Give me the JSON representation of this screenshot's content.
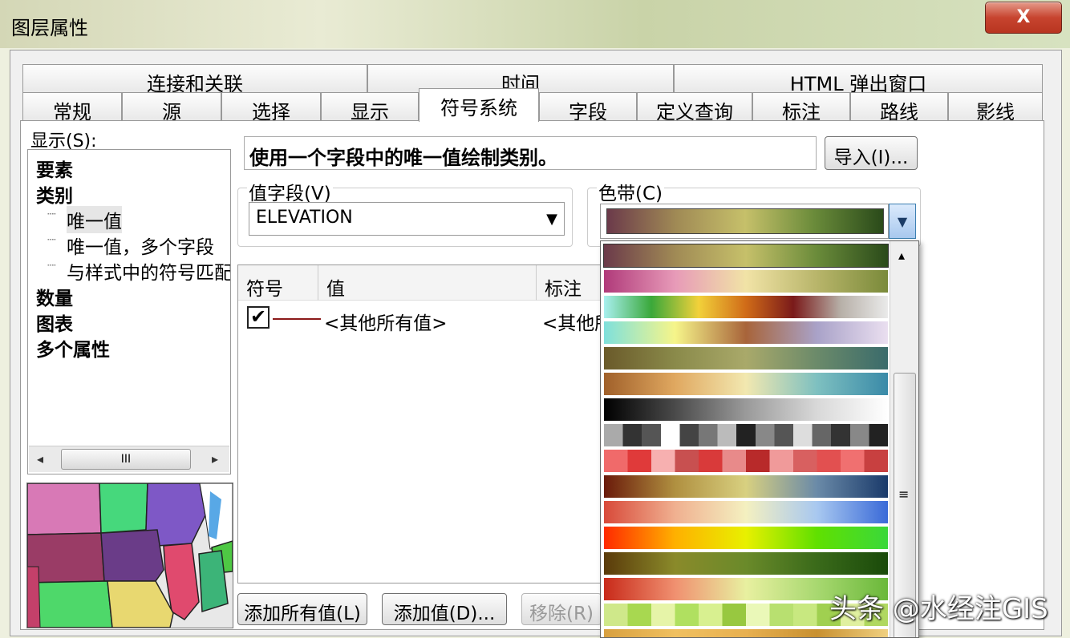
{
  "window": {
    "title": "图层属性",
    "close_label": "X"
  },
  "tabs_row1": [
    "连接和关联",
    "时间",
    "HTML 弹出窗口"
  ],
  "tabs_row2": [
    "常规",
    "源",
    "选择",
    "显示",
    "符号系统",
    "字段",
    "定义查询",
    "标注",
    "路线",
    "影线"
  ],
  "show_label": "显示(S):",
  "tree": {
    "items": [
      "要素",
      "类别",
      "唯一值",
      "唯一值，多个字段",
      "与样式中的符号匹配",
      "数量",
      "图表",
      "多个属性"
    ],
    "connectors": [
      "┈",
      "┈",
      "┈"
    ]
  },
  "tree_scroll": {
    "left_arrow": "◂",
    "right_arrow": "▸",
    "thumb_grip": "III"
  },
  "description": "使用一个字段中的唯一值绘制类别。",
  "import_button": "导入(I)...",
  "value_field": {
    "label": "值字段(V)",
    "value": "ELEVATION",
    "arrow": "▼"
  },
  "color_ramp": {
    "label": "色带(C)",
    "arrow": "▼"
  },
  "list": {
    "headers": [
      "符号",
      "值",
      "标注"
    ],
    "rows": [
      {
        "checked": "✔",
        "value": "<其他所有值>",
        "label": "<其他所有值>"
      }
    ]
  },
  "buttons": {
    "add_all": "添加所有值(L)",
    "add_value": "添加值(D)...",
    "remove": "移除(R)"
  },
  "popup_scroll": {
    "up_arrow": "▴",
    "grip": "≡"
  },
  "watermark": "头条 @水经注GIS",
  "ramps": [
    [
      "#6b3a4a",
      "#a08a55",
      "#c6c06a",
      "#6a8b3a",
      "#2a4a1a"
    ],
    [
      "#b03a7a",
      "#e79ab8",
      "#f1e3a6",
      "#b8b56a",
      "#7a8a3a"
    ],
    [
      "#a8f0ef",
      "#3aa83a",
      "#f2d13a",
      "#d06b18",
      "#7a1a1a",
      "#b7b0a8",
      "#eaeaea"
    ],
    [
      "#7ee0dc",
      "#f6f58a",
      "#a8643a",
      "#a9a2c8",
      "#eadff0"
    ],
    [
      "#6a5a2a",
      "#8a8a4a",
      "#a9a96a",
      "#6b8a6a",
      "#3a6b6b"
    ],
    [
      "#a0602a",
      "#e0a860",
      "#f2e8b0",
      "#7ec0c0",
      "#3a8aa8"
    ],
    [
      "#000000",
      "#4a4a4a",
      "#9a9a9a",
      "#d8d8d8",
      "#ffffff"
    ],
    [
      "#aaaaaa",
      "#333333",
      "#555555",
      "#ffffff",
      "#444444",
      "#777777",
      "#bbbbbb",
      "#222222",
      "#888888",
      "#555555",
      "#dddddd",
      "#666666",
      "#333333",
      "#888888",
      "#222222"
    ],
    [
      "#f06a6a",
      "#e03a3a",
      "#f7b0b0",
      "#c85050",
      "#d93a3a",
      "#e88a8a",
      "#b82a2a",
      "#f09a9a",
      "#d86060",
      "#e25050",
      "#f07070",
      "#c84040"
    ],
    [
      "#6a1a0a",
      "#b09040",
      "#d8d080",
      "#6a8aa8",
      "#1a3a6a"
    ],
    [
      "#d84a3a",
      "#f0b090",
      "#f4f0c0",
      "#a8c8f0",
      "#3a6ad8"
    ],
    [
      "#ff2a00",
      "#ffb000",
      "#e8f000",
      "#60e000",
      "#3ad83a"
    ],
    [
      "#5a3a0a",
      "#8a8a2a",
      "#6a8a2a",
      "#3a6a1a",
      "#1a4a0a"
    ],
    [
      "#c82a1a",
      "#f09070",
      "#e8f0a0",
      "#a8d870",
      "#6ab83a"
    ],
    [
      "#cfe88a",
      "#a8d850",
      "#e6f4a8",
      "#b0e060",
      "#d8f090",
      "#98c840",
      "#eaf8b8",
      "#b8e070",
      "#c8e880",
      "#a0d050",
      "#e0f0a0",
      "#b0d860"
    ],
    [
      "#d8a040",
      "#f0c060",
      "#e8b050",
      "#c89030",
      "#f0d080"
    ]
  ]
}
